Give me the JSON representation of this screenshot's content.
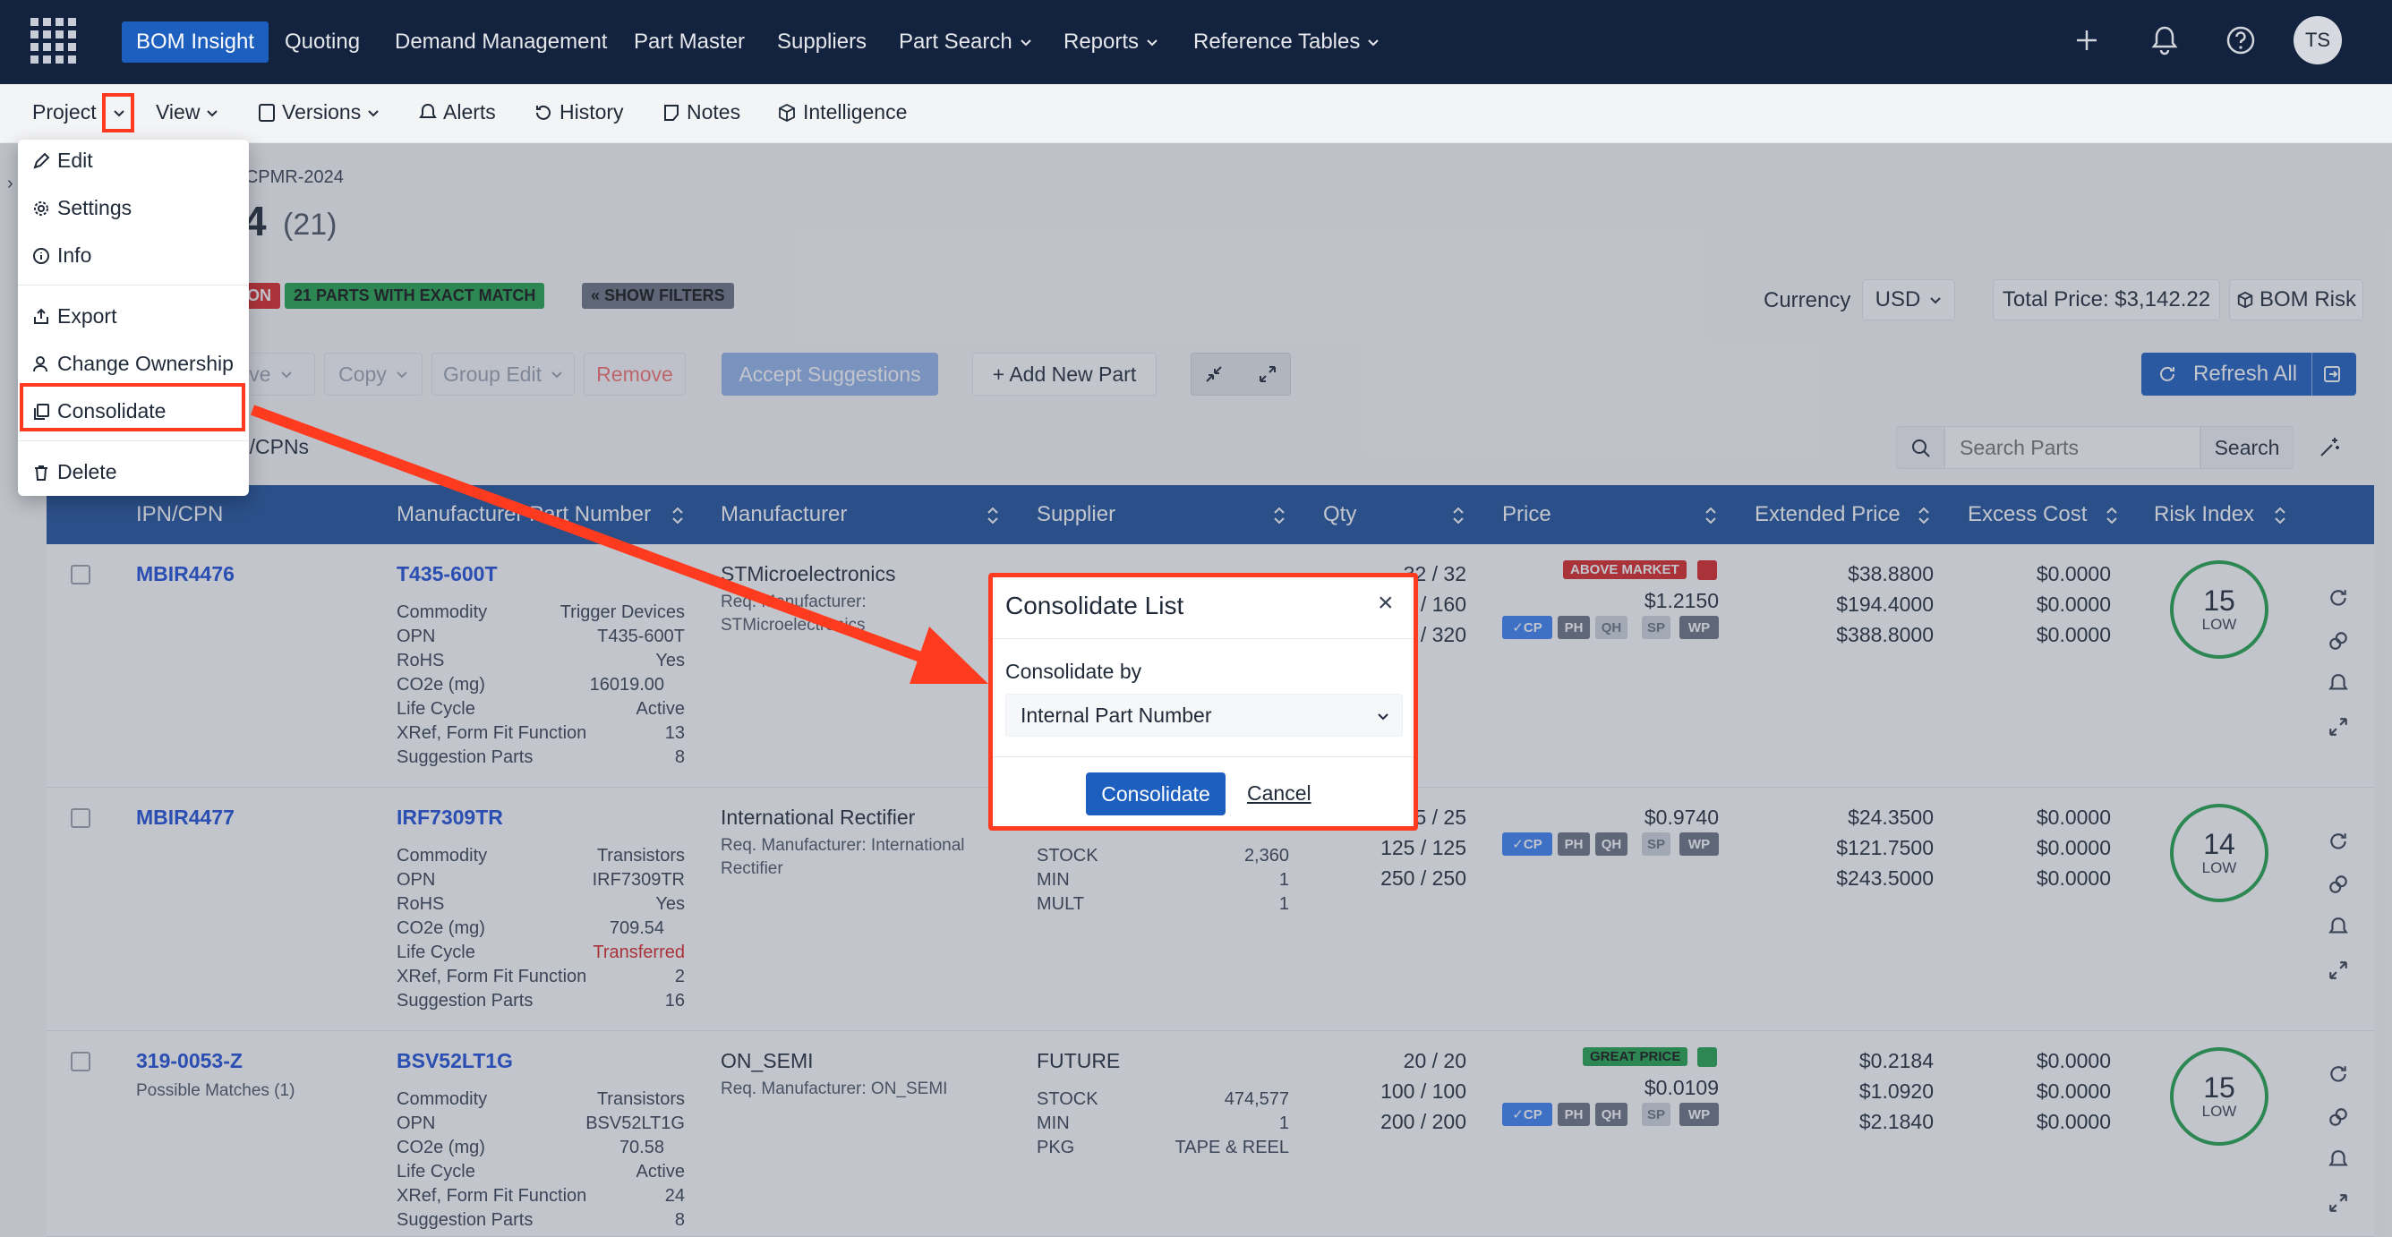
{
  "nav": {
    "items": [
      "BOM Insight",
      "Quoting",
      "Demand Management",
      "Part Master",
      "Suppliers",
      "Part Search",
      "Reports",
      "Reference Tables"
    ],
    "avatar": "TS"
  },
  "toolbar": {
    "project": "Project",
    "view": "View",
    "versions": "Versions",
    "alerts": "Alerts",
    "history": "History",
    "notes": "Notes",
    "intelligence": "Intelligence"
  },
  "page": {
    "breadcrumb_link": "cts",
    "breadcrumb_sep": "»",
    "breadcrumb_current": "CPMR-2024",
    "title_fragment": "4",
    "title_count": "(21)",
    "tag_red": "ON",
    "tag_green": "21 PARTS WITH EXACT MATCH",
    "show_filters": "« SHOW FILTERS",
    "currency_label": "Currency",
    "currency_value": "USD",
    "total_price": "Total Price: $3,142.22",
    "bom_risk": "BOM Risk",
    "actions": {
      "move": "ove",
      "copy": "Copy",
      "group_edit": "Group Edit",
      "remove": "Remove",
      "accept": "Accept Suggestions",
      "add_new": "+ Add New Part",
      "refresh_all": "Refresh All"
    },
    "filter_label": "N/CPNs",
    "search_placeholder": "Search Parts",
    "search_button": "Search"
  },
  "table": {
    "headers": [
      "IPN/CPN",
      "Manufacturer Part Number",
      "Manufacturer",
      "Supplier",
      "Qty",
      "Price",
      "Extended Price",
      "Excess Cost",
      "Risk Index"
    ],
    "rows": [
      {
        "ipn": "MBIR4476",
        "mpn": "T435-600T",
        "attrs": [
          [
            "Commodity",
            "Trigger Devices"
          ],
          [
            "OPN",
            "T435-600T"
          ],
          [
            "RoHS",
            "Yes"
          ],
          [
            "CO2e (mg)",
            "16019.00"
          ],
          [
            "Life Cycle",
            "Active"
          ],
          [
            "XRef, Form Fit Function",
            "13"
          ],
          [
            "Suggestion Parts",
            "8"
          ]
        ],
        "manufacturer": "STMicroelectronics",
        "req_mfr_1": "Req. Manufacturer:",
        "req_mfr_2": "STMicroelectronics",
        "qty": [
          "32 / 32",
          "160 / 160",
          "320 / 320"
        ],
        "price_tag": "ABOVE MARKET",
        "price": "$1.2150",
        "ext": [
          "$38.8800",
          "$194.4000",
          "$388.8000"
        ],
        "excess": [
          "$0.0000",
          "$0.0000",
          "$0.0000"
        ],
        "risk": "15",
        "risk_label": "LOW"
      },
      {
        "ipn": "MBIR4477",
        "mpn": "IRF7309TR",
        "attrs": [
          [
            "Commodity",
            "Transistors"
          ],
          [
            "OPN",
            "IRF7309TR"
          ],
          [
            "RoHS",
            "Yes"
          ],
          [
            "CO2e (mg)",
            "709.54"
          ],
          [
            "Life Cycle",
            "Transferred"
          ],
          [
            "XRef, Form Fit Function",
            "2"
          ],
          [
            "Suggestion Parts",
            "16"
          ]
        ],
        "manufacturer": "International Rectifier",
        "req_mfr_1": "Req. Manufacturer: International",
        "req_mfr_2": "Rectifier",
        "stock": [
          [
            "STOCK",
            "2,360"
          ],
          [
            "MIN",
            "1"
          ],
          [
            "MULT",
            "1"
          ]
        ],
        "qty": [
          "25 / 25",
          "125 / 125",
          "250 / 250"
        ],
        "price": "$0.9740",
        "ext": [
          "$24.3500",
          "$121.7500",
          "$243.5000"
        ],
        "excess": [
          "$0.0000",
          "$0.0000",
          "$0.0000"
        ],
        "risk": "14",
        "risk_label": "LOW"
      },
      {
        "ipn": "319-0053-Z",
        "possible": "Possible Matches (1)",
        "mpn": "BSV52LT1G",
        "attrs": [
          [
            "Commodity",
            "Transistors"
          ],
          [
            "OPN",
            "BSV52LT1G"
          ],
          [
            "CO2e (mg)",
            "70.58"
          ],
          [
            "Life Cycle",
            "Active"
          ],
          [
            "XRef, Form Fit Function",
            "24"
          ],
          [
            "Suggestion Parts",
            "8"
          ]
        ],
        "manufacturer": "ON_SEMI",
        "req_mfr_1": "Req. Manufacturer: ON_SEMI",
        "supplier": "FUTURE",
        "stock": [
          [
            "STOCK",
            "474,577"
          ],
          [
            "MIN",
            "1"
          ],
          [
            "PKG",
            "TAPE & REEL"
          ]
        ],
        "qty": [
          "20 / 20",
          "100 / 100",
          "200 / 200"
        ],
        "price_tag": "GREAT PRICE",
        "price": "$0.0109",
        "ext": [
          "$0.2184",
          "$1.0920",
          "$2.1840"
        ],
        "excess": [
          "$0.0000",
          "$0.0000",
          "$0.0000"
        ],
        "risk": "15",
        "risk_label": "LOW"
      }
    ],
    "chips": [
      "✓CP",
      "PH",
      "QH",
      "SP",
      "WP"
    ]
  },
  "dropdown": {
    "items": [
      "Edit",
      "Settings",
      "Info",
      "Export",
      "Change Ownership",
      "Consolidate",
      "Delete"
    ]
  },
  "modal": {
    "title": "Consolidate List",
    "close": "×",
    "label": "Consolidate by",
    "select_value": "Internal Part Number",
    "confirm": "Consolidate",
    "cancel": "Cancel"
  },
  "colors": {
    "nav_bg": "#13233f",
    "accent": "#1d5fbf",
    "annotation": "#ff3b1f",
    "table_header": "#1e4f9a"
  }
}
